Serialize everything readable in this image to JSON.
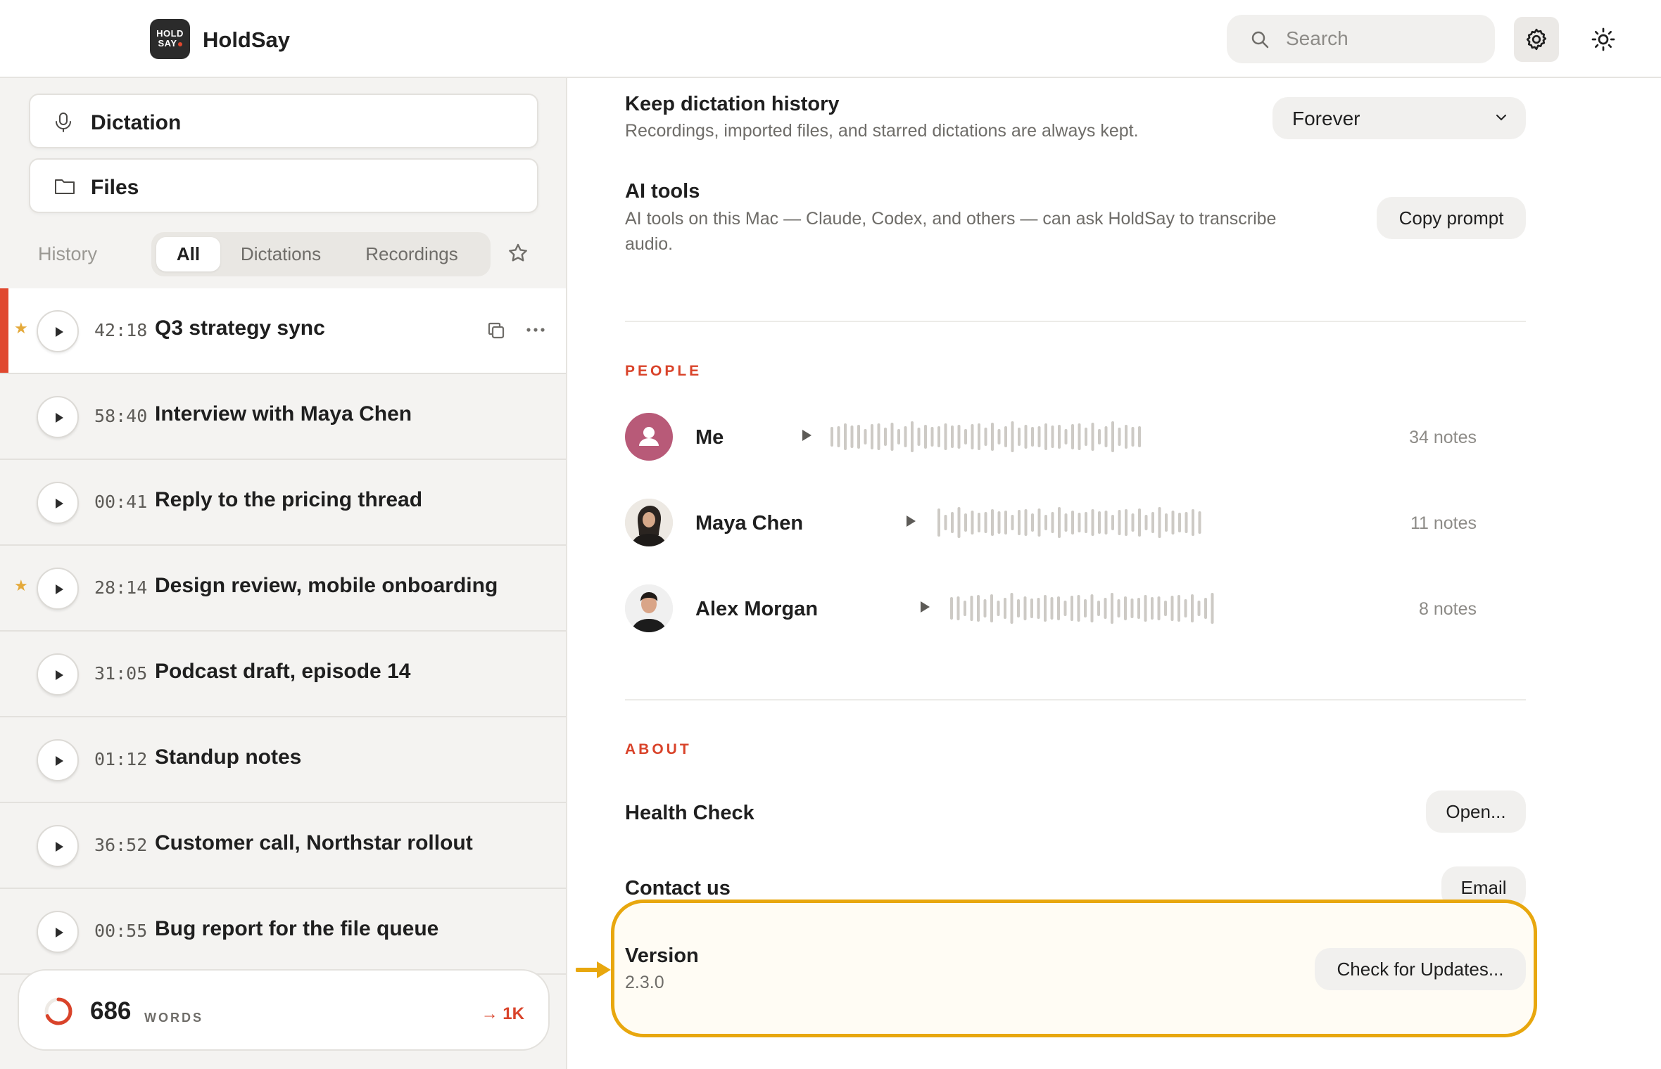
{
  "app": {
    "name": "HoldSay",
    "logo_text_top": "HOLD",
    "logo_text_bottom": "SAY"
  },
  "search": {
    "placeholder": "Search",
    "icon": "search-icon"
  },
  "header_buttons": {
    "settings_icon": "gear-icon",
    "theme_icon": "sun-icon"
  },
  "sidebar": {
    "nav": [
      {
        "label": "Dictation",
        "icon": "microphone-icon"
      },
      {
        "label": "Files",
        "icon": "folder-icon"
      }
    ],
    "history_label": "History",
    "filters": [
      "All",
      "Dictations",
      "Recordings"
    ],
    "active_filter": "All",
    "items": [
      {
        "duration": "42:18",
        "title": "Q3 strategy sync",
        "starred": true,
        "selected": true
      },
      {
        "duration": "58:40",
        "title": "Interview with Maya Chen",
        "starred": false
      },
      {
        "duration": "00:41",
        "title": "Reply to the pricing thread",
        "starred": false
      },
      {
        "duration": "28:14",
        "title": "Design review, mobile onboarding",
        "starred": true
      },
      {
        "duration": "31:05",
        "title": "Podcast draft, episode 14",
        "starred": false
      },
      {
        "duration": "01:12",
        "title": "Standup notes",
        "starred": false
      },
      {
        "duration": "36:52",
        "title": "Customer call, Northstar rollout",
        "starred": false
      },
      {
        "duration": "00:55",
        "title": "Bug report for the file queue",
        "starred": false
      }
    ],
    "words": {
      "count": "686",
      "label": "WORDS",
      "goal": "→ 1K",
      "progress_fraction": 0.686
    }
  },
  "settings": {
    "history": {
      "title": "Keep dictation history",
      "description": "Recordings, imported files, and starred dictations are always kept.",
      "value": "Forever"
    },
    "ai_tools": {
      "title": "AI tools",
      "description_line1": "AI tools on this Mac — Claude, Codex, and others — can ask HoldSay to transcribe",
      "description_line2": "audio.",
      "button": "Copy prompt"
    },
    "people_label": "PEOPLE",
    "people": [
      {
        "name": "Me",
        "notes": "34 notes",
        "avatar": "user-icon"
      },
      {
        "name": "Maya Chen",
        "notes": "11 notes",
        "avatar": "photo"
      },
      {
        "name": "Alex Morgan",
        "notes": "8 notes",
        "avatar": "photo"
      }
    ],
    "about_label": "ABOUT",
    "health": {
      "title": "Health Check",
      "button": "Open..."
    },
    "contact": {
      "title": "Contact us",
      "button": "Email"
    },
    "version": {
      "title": "Version",
      "value": "2.3.0",
      "button": "Check for Updates..."
    }
  },
  "colors": {
    "accent": "#d9432a",
    "highlight": "#e8a70e",
    "star": "#e4a93a"
  }
}
